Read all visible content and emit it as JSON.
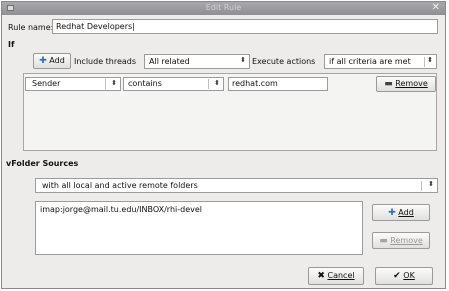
{
  "window": {
    "title": "Edit Rule"
  },
  "rule": {
    "name_label": "Rule name:",
    "name_value": "Redhat Developers"
  },
  "if_section": {
    "heading": "If",
    "add_label": "Add",
    "include_label": "Include threads",
    "include_value": "All related",
    "execute_label": "Execute actions",
    "execute_value": "if all criteria are met"
  },
  "criteria": [
    {
      "field": "Sender",
      "operator": "contains",
      "value": "redhat.com",
      "remove_label": "Remove"
    }
  ],
  "sources": {
    "heading": "vFolder Sources",
    "scope_value": "with all local and active remote folders",
    "folders": [
      "imap:jorge@mail.tu.edu/INBOX/rhi-devel"
    ],
    "add_label": "Add",
    "remove_label": "Remove"
  },
  "dialog": {
    "cancel_label": "Cancel",
    "ok_label": "OK"
  },
  "icons": {
    "add": "plus-icon",
    "remove": "minus-icon",
    "cancel": "x-icon",
    "ok": "check-icon",
    "combo": "updown-arrow-icon"
  }
}
